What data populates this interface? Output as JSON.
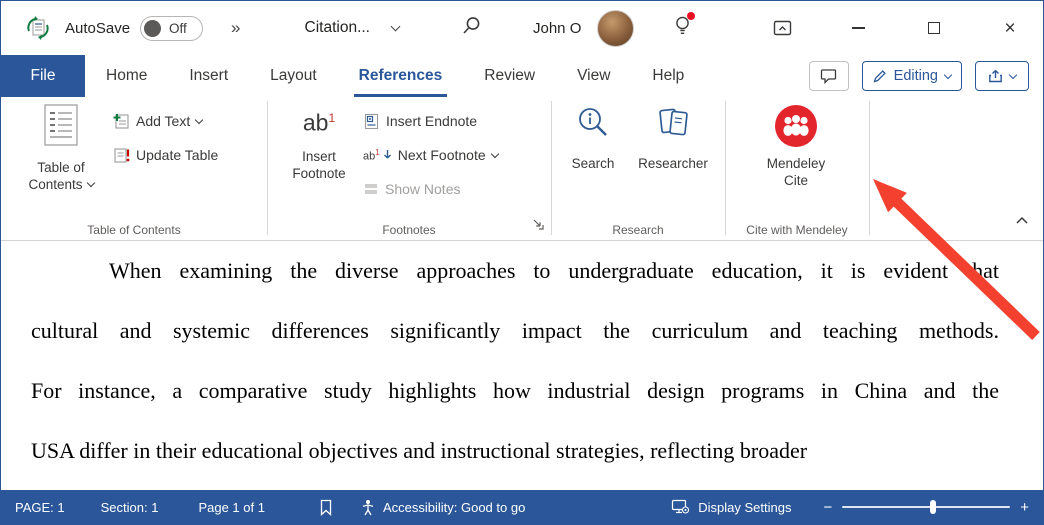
{
  "colors": {
    "accent": "#2b579a",
    "status_bg": "#2b579a",
    "mendeley_red": "#e2262c",
    "arrow_red": "#f4402e"
  },
  "glyphs": {
    "double_chevron": "»",
    "close": "×",
    "zoom_out": "−",
    "zoom_in": "+",
    "footnote_ab": "ab",
    "footnote_sup": "1"
  },
  "title_bar": {
    "autosave_label": "AutoSave",
    "autosave_state": "Off",
    "document_title": "Citation...",
    "user_name": "John O"
  },
  "tabs": {
    "file": "File",
    "items": [
      "Home",
      "Insert",
      "Layout",
      "References",
      "Review",
      "View",
      "Help"
    ],
    "active": "References",
    "editing_button": "Editing"
  },
  "ribbon": {
    "toc_group": {
      "toc_line1": "Table of",
      "toc_line2": "Contents",
      "add_text": "Add Text",
      "update_table": "Update Table",
      "label": "Table of Contents"
    },
    "footnotes_group": {
      "insert_line1": "Insert",
      "insert_line2": "Footnote",
      "insert_endnote": "Insert Endnote",
      "next_footnote": "Next Footnote",
      "show_notes": "Show Notes",
      "label": "Footnotes"
    },
    "research_group": {
      "search": "Search",
      "researcher": "Researcher",
      "label": "Research"
    },
    "mendeley_group": {
      "line1": "Mendeley",
      "line2": "Cite",
      "label": "Cite with Mendeley"
    }
  },
  "document": {
    "lines": [
      "When examining the diverse approaches to undergraduate education, it is evident that",
      "cultural and systemic differences significantly impact the curriculum and teaching methods.",
      "For instance, a comparative study highlights how industrial design programs in China and the",
      "USA differ in their educational objectives and instructional strategies, reflecting broader"
    ]
  },
  "status_bar": {
    "page": "PAGE: 1",
    "section": "Section: 1",
    "page_of": "Page 1 of 1",
    "accessibility": "Accessibility: Good to go",
    "display_settings": "Display Settings"
  }
}
